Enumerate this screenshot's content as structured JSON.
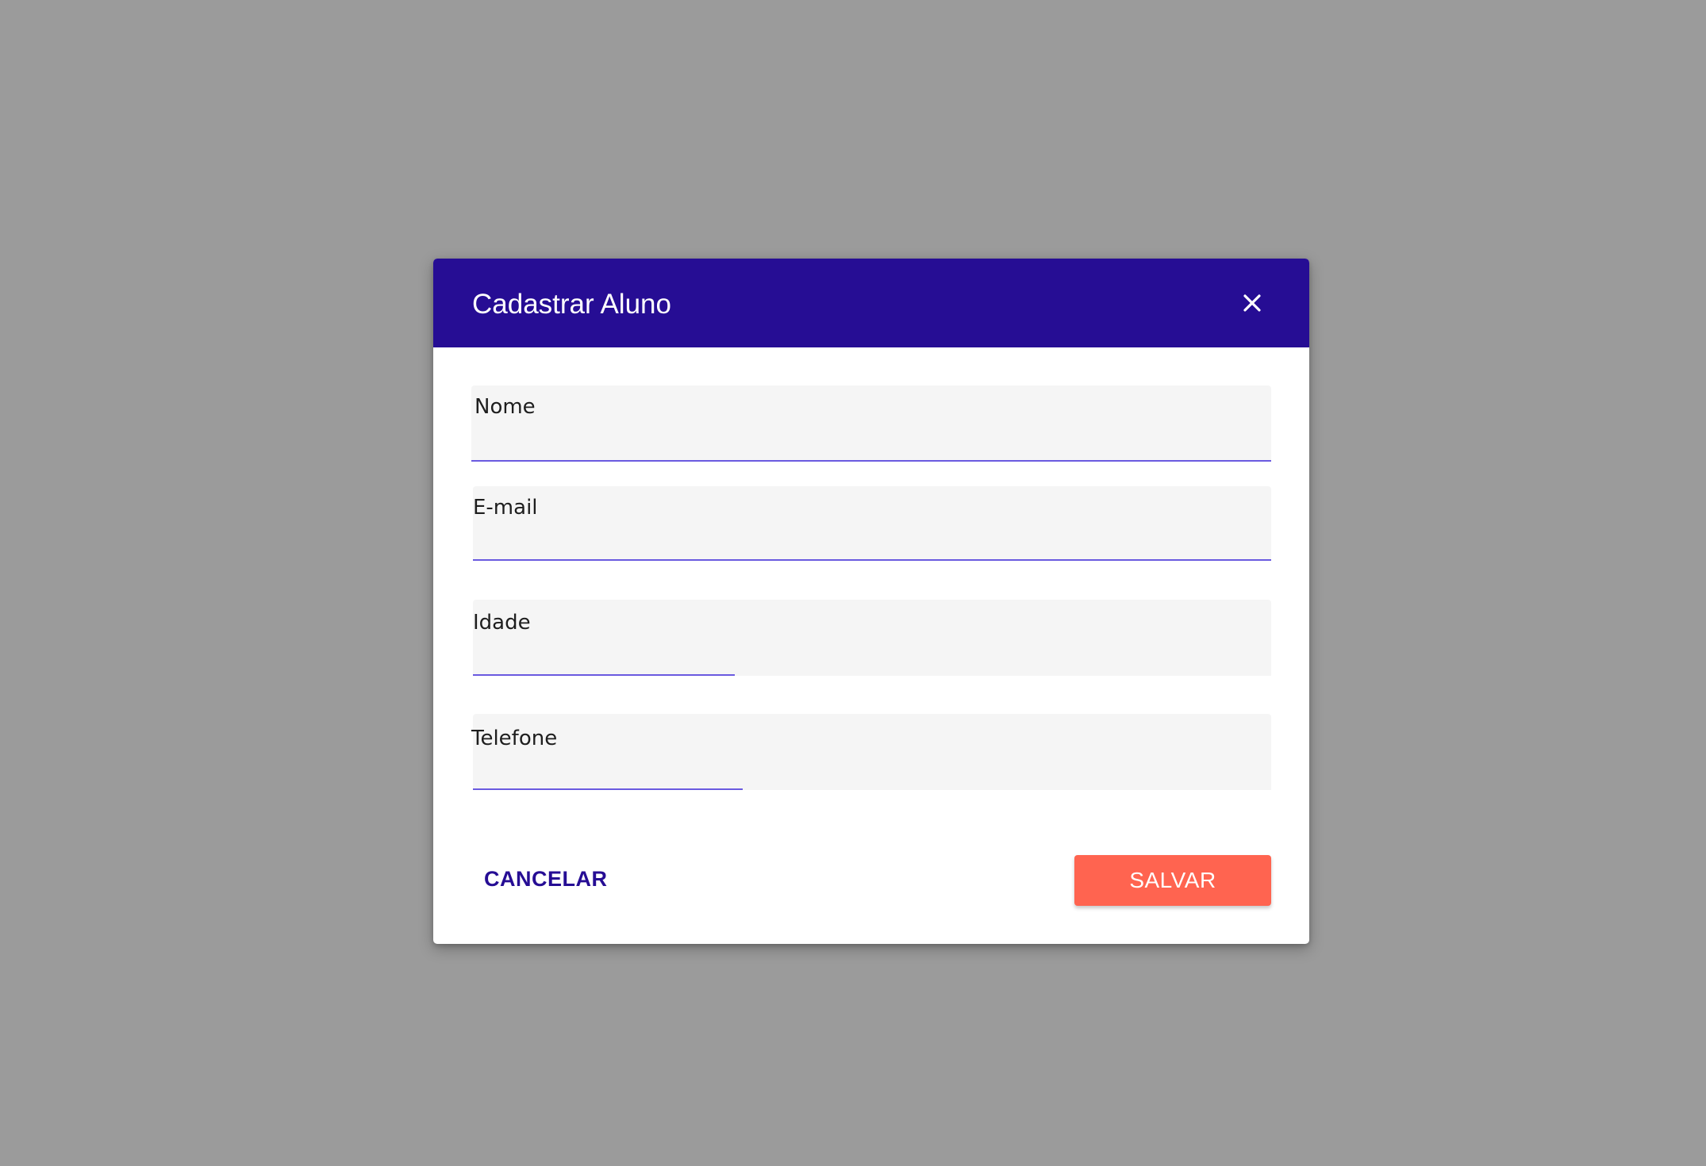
{
  "dialog": {
    "title": "Cadastrar Aluno",
    "close_icon": "close-icon"
  },
  "form": {
    "fields": [
      {
        "label": "Nome",
        "value": "",
        "placeholder": ""
      },
      {
        "label": "E-mail",
        "value": "",
        "placeholder": ""
      },
      {
        "label": "Idade",
        "value": "",
        "placeholder": ""
      },
      {
        "label": "Telefone",
        "value": "",
        "placeholder": ""
      }
    ]
  },
  "actions": {
    "cancel_label": "CANCELAR",
    "save_label": "SALVAR"
  },
  "colors": {
    "header": "#260d94",
    "primary_text": "#260d94",
    "save_button": "#ff6450",
    "underline": "#6a5ae0",
    "overlay": "#9b9b9b"
  }
}
